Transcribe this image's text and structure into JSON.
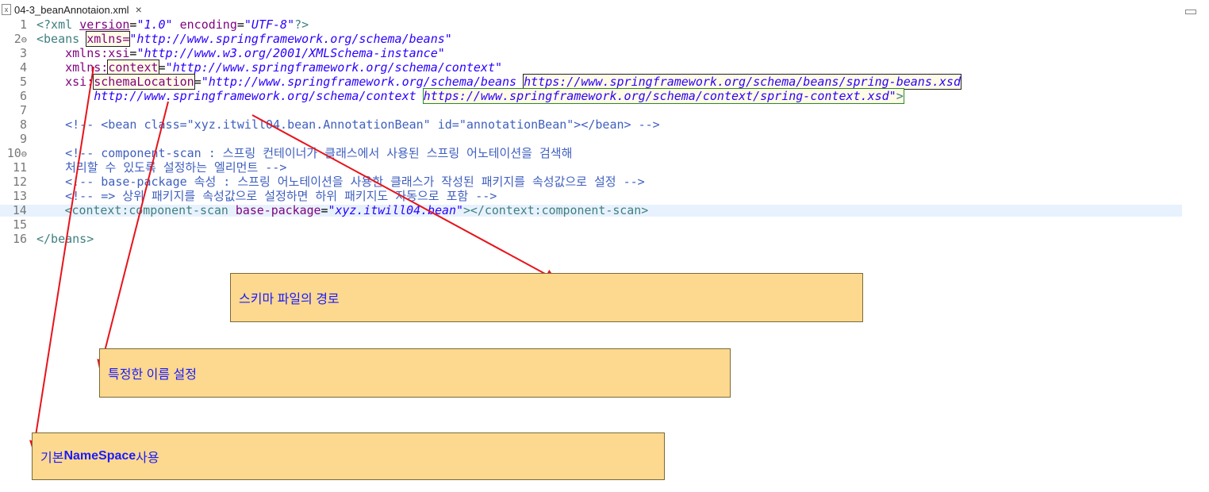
{
  "tab": {
    "title": "04-3_beanAnnotaion.xml",
    "icon": "xml-file-icon",
    "close_label": "×"
  },
  "editor": {
    "lines": [
      {
        "no": "1",
        "fold": ""
      },
      {
        "no": "2",
        "fold": "⊖"
      },
      {
        "no": "3",
        "fold": ""
      },
      {
        "no": "4",
        "fold": ""
      },
      {
        "no": "5",
        "fold": ""
      },
      {
        "no": "6",
        "fold": ""
      },
      {
        "no": "7",
        "fold": ""
      },
      {
        "no": "8",
        "fold": ""
      },
      {
        "no": "9",
        "fold": ""
      },
      {
        "no": "10",
        "fold": "⊖"
      },
      {
        "no": "11",
        "fold": ""
      },
      {
        "no": "12",
        "fold": ""
      },
      {
        "no": "13",
        "fold": ""
      },
      {
        "no": "14",
        "fold": ""
      },
      {
        "no": "15",
        "fold": ""
      },
      {
        "no": "16",
        "fold": ""
      }
    ],
    "code": {
      "l1": {
        "open": "<?xml ",
        "a1": "version",
        "eq1": "=",
        "v1": "\"1.0\"",
        "sp": " ",
        "a2": "encoding",
        "eq2": "=",
        "v2": "\"UTF-8\"",
        "close": "?>"
      },
      "l2": {
        "open": "<beans ",
        "a": "xmlns=",
        "v": "\"http://www.springframework.org/schema/beans\""
      },
      "l3": {
        "indent": "    ",
        "a": "xmlns:xsi",
        "eq": "=",
        "v": "\"http://www.w3.org/2001/XMLSchema-instance\""
      },
      "l4": {
        "indent": "    ",
        "a1": "xmlns:",
        "a2": "context",
        "eq": "=",
        "v": "\"http://www.springframework.org/schema/context\""
      },
      "l5": {
        "indent": "    ",
        "a1": "xsi:",
        "a2": "schemaLocation",
        "eq": "=",
        "v1": "\"http://www.springframework.org/schema/beans ",
        "v2": "https://www.springframework.org/schema/beans/spring-beans.xsd"
      },
      "l6": {
        "indent": "        ",
        "v1": "http://www.springframework.org/schema/context ",
        "v2": "https://www.springframework.org/schema/context/spring-context.xsd\"",
        "close": ">"
      },
      "l8": {
        "indent": "    ",
        "c": "<!-- <bean class=\"xyz.itwill04.bean.AnnotationBean\" id=\"annotationBean\"></bean> -->"
      },
      "l10": {
        "indent": "    ",
        "c": "<!-- component-scan : 스프링 컨테이너가 클래스에서 사용된 스프링 어노테이션을 검색해"
      },
      "l11": {
        "indent": "    ",
        "c": "처리할 수 있도록 설정하는 엘리먼트 -->"
      },
      "l12": {
        "indent": "    ",
        "c": "<!-- base-package 속성 : 스프링 어노테이션을 사용한 클래스가 작성된 패키지를 속성값으로 설정 -->"
      },
      "l13": {
        "indent": "    ",
        "c": "<!-- => 상위 패키지를 속성값으로 설정하면 하위 패키지도 자동으로 포함 -->"
      },
      "l14": {
        "indent": "    ",
        "open": "<context:component-scan ",
        "a": "base-package",
        "eq": "=",
        "v": "\"xyz.itwill04.bean\"",
        "close": "></context:component-scan>"
      },
      "l16": {
        "close": "</beans>"
      }
    }
  },
  "callouts": {
    "schema": "스키마 파일의 경로",
    "prefix": "특정한 이름 설정",
    "default_pre": "기본 ",
    "default_bold": "NameSpace",
    "default_post": " 사용"
  },
  "colors": {
    "callout_bg": "#fcd98e",
    "callout_text": "#1a1aff",
    "arrow": "#e8131b"
  }
}
